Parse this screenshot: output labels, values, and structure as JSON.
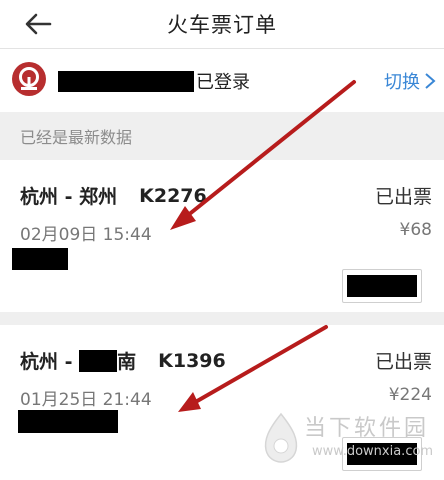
{
  "header": {
    "title": "火车票订单",
    "back_icon": "arrow-left-icon"
  },
  "account": {
    "logo_icon": "railway-logo-icon",
    "login_status": "已登录",
    "switch_label": "切换",
    "switch_icon": "chevron-right-icon"
  },
  "status_message": "已经是最新数据",
  "orders": [
    {
      "route_from": "杭州 - ",
      "route_to": "郑州",
      "train": "K2276",
      "status": "已出票",
      "datetime": "02月09日 15:44",
      "price": "¥68"
    },
    {
      "route_from": "杭州 - ",
      "route_to": "南",
      "train": "K1396",
      "status": "已出票",
      "datetime": "01月25日 21:44",
      "price": "¥224"
    }
  ],
  "watermark": {
    "name": "当下软件园",
    "url": "www.downxia.com"
  },
  "colors": {
    "accent_blue": "#3a87d6",
    "logo_red": "#b72e2f",
    "arrow_red": "#b71c1c"
  }
}
